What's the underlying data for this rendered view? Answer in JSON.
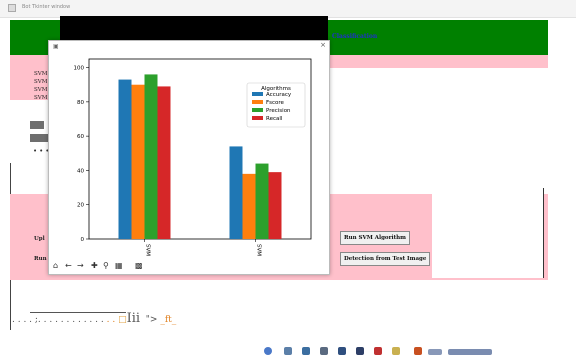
{
  "window": {
    "title": "Bot Tkinter window"
  },
  "app": {
    "header_title": "Classification",
    "svm_lines": [
      "SVM",
      "SVM",
      "SVM",
      "SVM"
    ],
    "upload_label": "Upl",
    "run_label": "Run",
    "run_svm_button": "Run SVM Algorithm",
    "detection_button": "Detection from Test Image",
    "garbled_text": ". . . . ;. . . . . . . . . . . .",
    "garbled_tail": ". .",
    "garbled_glyphs": "Iii",
    "garbled_quote": "\">",
    "garbled_ft": "_ft_"
  },
  "toolbar_icons": [
    "home-icon",
    "back-icon",
    "forward-icon",
    "pan-icon",
    "zoom-icon",
    "configure-icon",
    "save-icon"
  ],
  "taskbar_icons": [
    "chrome-icon",
    "settings-icon",
    "app-icon",
    "store-icon",
    "file-icon",
    "pdf-icon",
    "python-icon"
  ],
  "chart_data": {
    "type": "bar",
    "categories": [
      "SVM",
      "SVM"
    ],
    "series": [
      {
        "name": "Accuracy",
        "color": "#1f77b4",
        "values": [
          93,
          54
        ]
      },
      {
        "name": "Fscore",
        "color": "#ff7f0e",
        "values": [
          90,
          38
        ]
      },
      {
        "name": "Precision",
        "color": "#2ca02c",
        "values": [
          96,
          44
        ]
      },
      {
        "name": "Recall",
        "color": "#d62728",
        "values": [
          89,
          39
        ]
      }
    ],
    "legend_title": "Algorithms",
    "legend_position": "top-right",
    "ylim": [
      0,
      105
    ],
    "yticks": [
      0,
      20,
      40,
      60,
      80,
      100
    ],
    "grid": false
  }
}
